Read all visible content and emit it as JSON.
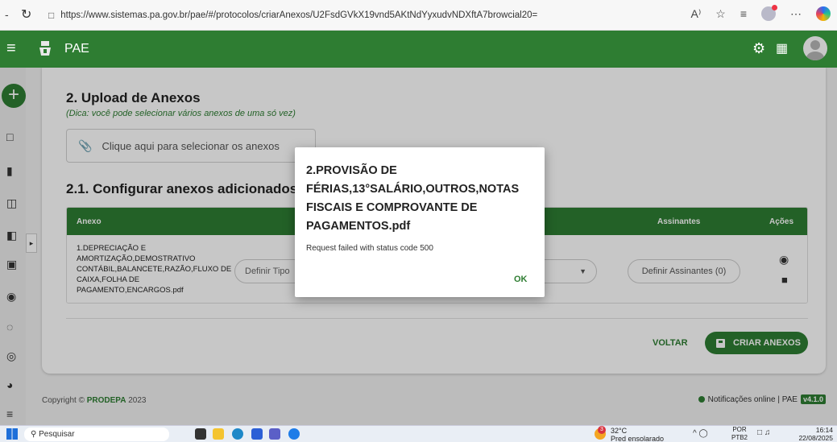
{
  "browser": {
    "url": "https://www.sistemas.pa.gov.br/pae/#/protocolos/criarAnexos/U2FsdGVkX19vnd5AKtNdYyxudvNDXftA7browcial20="
  },
  "header": {
    "title": "PAE"
  },
  "upload": {
    "title": "2. Upload de Anexos",
    "hint": "(Dica: você pode selecionar vários anexos de uma só vez)",
    "button_label": "Clique aqui para selecionar os anexos"
  },
  "config": {
    "title": "2.1. Configurar anexos adicionados",
    "columns": {
      "anexo": "Anexo",
      "assinantes": "Assinantes",
      "acoes": "Ações"
    },
    "rows": [
      {
        "file_name": "1.DEPRECIAÇÃO E AMORTIZAÇÃO,DEMOSTRATIVO CONTÁBIL,BALANCETE,RAZÃO,FLUXO DE CAIXA,FOLHA DE PAGAMENTO,ENCARGOS.pdf",
        "tipo_placeholder": "Definir Tipo",
        "assinantes_label": "Definir Assinantes (0)"
      }
    ]
  },
  "actions": {
    "voltar": "VOLTAR",
    "criar": "CRIAR ANEXOS"
  },
  "footer": {
    "copyright_prefix": "Copyright ©",
    "brand": "PRODEPA",
    "year": "2023",
    "notifications": "Notificações online | PAE",
    "version": "v4.1.0"
  },
  "dialog": {
    "title": "2.PROVISÃO DE FÉRIAS,13°SALÁRIO,OUTROS,NOTAS FISCAIS E COMPROVANTE DE PAGAMENTOS.pdf",
    "message": "Request failed with status code 500",
    "ok_label": "OK"
  },
  "taskbar": {
    "search_placeholder": "Pesquisar",
    "weather_temp": "32°C",
    "weather_desc": "Pred ensolarado",
    "weather_badge": "3",
    "lang_top": "POR",
    "lang_bottom": "PTB2",
    "time": "16:14",
    "date": "22/08/2025"
  },
  "colors": {
    "primary": "#2e7d32"
  }
}
